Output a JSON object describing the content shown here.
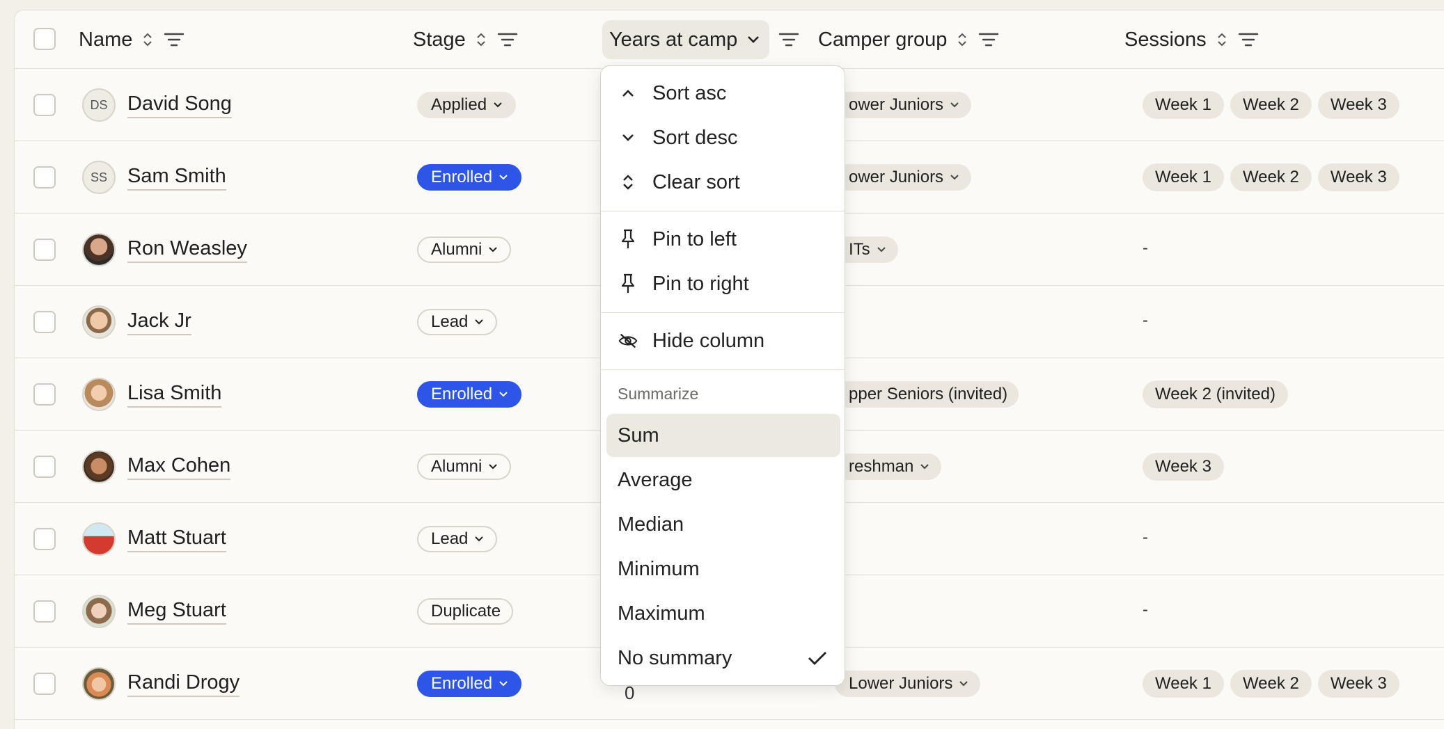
{
  "header": {
    "columns": {
      "name": "Name",
      "stage": "Stage",
      "years": "Years at camp",
      "group": "Camper group",
      "sessions": "Sessions"
    }
  },
  "rows": [
    {
      "initials": "DS",
      "name": "David Song",
      "stage": "Applied",
      "group": "ower Juniors",
      "sessions": [
        "Week 1",
        "Week 2",
        "Week 3"
      ]
    },
    {
      "initials": "SS",
      "name": "Sam Smith",
      "stage": "Enrolled",
      "group": "ower Juniors",
      "sessions": [
        "Week 1",
        "Week 2",
        "Week 3"
      ]
    },
    {
      "name": "Ron Weasley",
      "stage": "Alumni",
      "group": "ITs",
      "sessions_empty": "-"
    },
    {
      "name": "Jack Jr",
      "stage": "Lead",
      "sessions_empty": "-"
    },
    {
      "name": "Lisa Smith",
      "stage": "Enrolled",
      "group": "pper Seniors (invited)",
      "sessions": [
        "Week 2 (invited)"
      ]
    },
    {
      "name": "Max Cohen",
      "stage": "Alumni",
      "group": "reshman",
      "sessions": [
        "Week 3"
      ]
    },
    {
      "name": "Matt Stuart",
      "stage": "Lead",
      "sessions_empty": "-"
    },
    {
      "name": "Meg Stuart",
      "stage": "Duplicate",
      "sessions_empty": "-"
    },
    {
      "name": "Randi Drogy",
      "stage": "Enrolled",
      "years": "0",
      "group": "Lower Juniors",
      "sessions": [
        "Week 1",
        "Week 2",
        "Week 3"
      ]
    }
  ],
  "menu": {
    "sort_asc": "Sort asc",
    "sort_desc": "Sort desc",
    "clear_sort": "Clear sort",
    "pin_left": "Pin to left",
    "pin_right": "Pin to right",
    "hide_column": "Hide column",
    "summarize_label": "Summarize",
    "sum": "Sum",
    "average": "Average",
    "median": "Median",
    "minimum": "Minimum",
    "maximum": "Maximum",
    "no_summary": "No summary"
  },
  "colors": {
    "enrolled_blue": "#2d55e8",
    "background": "#f3f0e9"
  }
}
